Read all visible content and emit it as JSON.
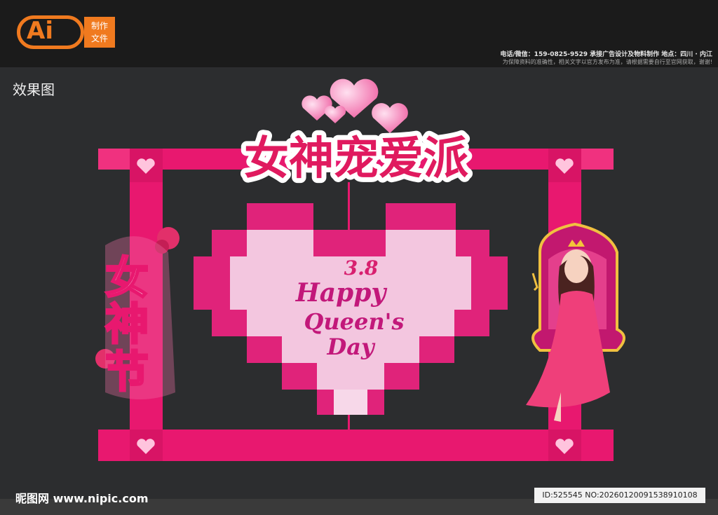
{
  "header": {
    "logo_text": "Ai",
    "logo_box_line1": "制作",
    "logo_box_line2": "文件",
    "contact": "电话/微信：159-0825-9529  承接广告设计及物料制作  地点：四川 · 内江",
    "notice": "为保障资料的准确性，相关文字以官方发布为准，请根据需要自行至官网获取，谢谢!"
  },
  "label": "效果图",
  "artwork": {
    "title": "女神宠爱派",
    "side_text": "女神节",
    "center_line1": "3.8",
    "center_line2": "Happy",
    "center_line3": "Queen's",
    "center_line4": "Day"
  },
  "footer": {
    "watermark": "昵图网 www.nipic.com",
    "id": "ID:525545 NO:20260120091538910108"
  },
  "colors": {
    "frame": "#e8186f",
    "heart_outer": "#e0237a",
    "heart_inner": "#f3c6df",
    "background": "#2c2d2f",
    "accent": "#f07a1f"
  }
}
